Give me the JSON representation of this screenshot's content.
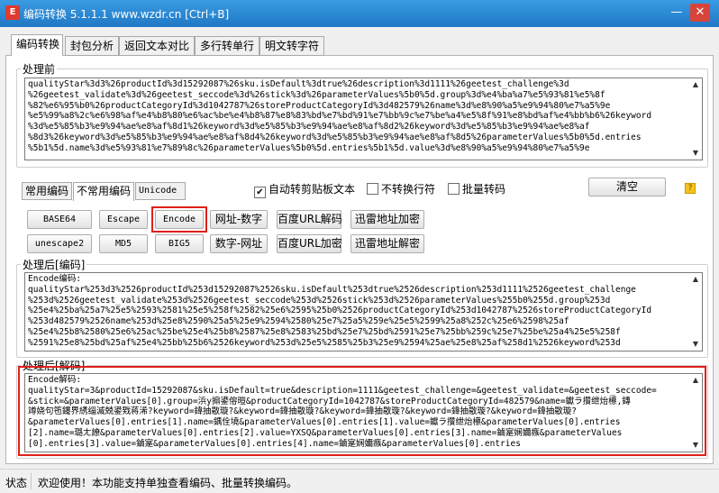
{
  "titlebar": {
    "title": "编码转换 5.1.1.1 www.wzdr.cn [Ctrl+B]",
    "app_icon": "E",
    "minimize": "—",
    "close": "✕"
  },
  "top_tabs": [
    "编码转换",
    "封包分析",
    "返回文本对比",
    "多行转单行",
    "明文转字符"
  ],
  "before": {
    "label": "处理前",
    "text": "qualityStar%3d3%26productId%3d15292087%26sku.isDefault%3dtrue%26description%3d1111%26geetest_challenge%3d\n%26geetest_validate%3d%26geetest_seccode%3d%26stick%3d%26parameterValues%5b0%5d.group%3d%e4%ba%a7%e5%93%81%e5%8f\n%82%e6%95%b0%26productCategoryId%3d1042787%26storeProductCategoryId%3d482579%26name%3d%e8%90%a5%e9%94%80%e7%a5%9e\n%e5%99%a8%2c%e6%98%af%e4%b8%80%e6%ac%be%e4%b8%87%e8%83%bd%e7%bd%91%e7%bb%9c%e7%be%a4%e5%8f%91%e8%bd%af%e4%bb%b6%26keyword\n%3d%e5%85%b3%e9%94%ae%e8%af%8d1%26keyword%3d%e5%85%b3%e9%94%ae%e8%af%8d2%26keyword%3d%e5%85%b3%e9%94%ae%e8%af\n%8d3%26keyword%3d%e5%85%b3%e9%94%ae%e8%af%8d4%26keyword%3d%e5%85%b3%e9%94%ae%e8%af%8d5%26parameterValues%5b0%5d.entries\n%5b1%5d.name%3d%e5%93%81%e7%89%8c%26parameterValues%5b0%5d.entries%5b1%5d.value%3d%e8%90%a5%e9%94%80%e7%a5%9e"
  },
  "mid_tabs": [
    "常用编码",
    "不常用编码",
    "Unicode"
  ],
  "checkboxes": [
    {
      "label": "自动转剪贴板文本",
      "checked": true
    },
    {
      "label": "不转换行符",
      "checked": false
    },
    {
      "label": "批量转码",
      "checked": false
    }
  ],
  "clear_button": "清空",
  "help_icon": "?",
  "buttons_row1": [
    "BASE64",
    "Escape",
    "Encode",
    "网址-数字",
    "百度URL解码",
    "迅雷地址加密"
  ],
  "buttons_row2": [
    "unescape2",
    "MD5",
    "BIG5",
    "数字-网址",
    "百度URL加密",
    "迅雷地址解密"
  ],
  "after_encode": {
    "label": "处理后[编码]",
    "text": "Encode编码:\nqualityStar%253d3%2526productId%253d15292087%2526sku.isDefault%253dtrue%2526description%253d1111%2526geetest_challenge\n%253d%2526geetest_validate%253d%2526geetest_seccode%253d%2526stick%253d%2526parameterValues%255b0%255d.group%253d\n%25e4%25ba%25a7%25e5%2593%2581%25e5%258f%2582%25e6%2595%25b0%2526productCategoryId%253d1042787%2526storeProductCategoryId\n%253d482579%2526name%253d%25e8%2590%25a5%25e9%2594%2580%25e7%25a5%259e%25e5%2599%25a8%252c%25e6%2598%25af\n%25e4%25b8%2580%25e6%25ac%25be%25e4%25b8%2587%25e8%2583%25bd%25e7%25bd%2591%25e7%25bb%259c%25e7%25be%25a4%25e5%258f\n%2591%25e8%25bd%25af%25e4%25bb%25b6%2526keyword%253d%25e5%2585%25b3%25e9%2594%25ae%25e8%25af%258d1%2526keyword%253d"
  },
  "after_decode": {
    "label": "处理后[解码]",
    "text": "Encode解码:\nqualityStar=3&productId=15292087&sku.isDefault=true&description=1111&geetest_challenge=&geetest_validate=&geetest_seccode=\n&stick=&parameterValues[0].group=浜у搧鍙傛暟&productCategoryId=1042787&storeProductCategoryId=482579&name=钀ラ攢绁炲櫒,鏄\n竴娆句竾鑳界綉缁滅兢鍙戣蒋浠?keyword=鍏抽敭璇?&keyword=鍏抽敭璇?&keyword=鍏抽敭璇?&keyword=鍏抽敭璇?&keyword=鍏抽敭璇?\n&parameterValues[0].entries[1].name=鍝佺墝&parameterValues[0].entries[1].value=钀ラ攢绁炲櫒&parameterValues[0].entries\n[2].name=璐ㄤ繚&parameterValues[0].entries[2].value=YXSQ&parameterValues[0].entries[3].name=鏀寔娴嬭瘯&parameterValues\n[0].entries[3].value=鏀寔&parameterValues[0].entries[4].name=鏀寔娴嬭瘯&parameterValues[0].entries"
  },
  "status": {
    "label": "状态",
    "message": "欢迎使用！本功能支持单独查看编码、批量转换编码。"
  },
  "colors": {
    "highlight": "#e0201a",
    "titlebar": "#2b8ad6"
  }
}
